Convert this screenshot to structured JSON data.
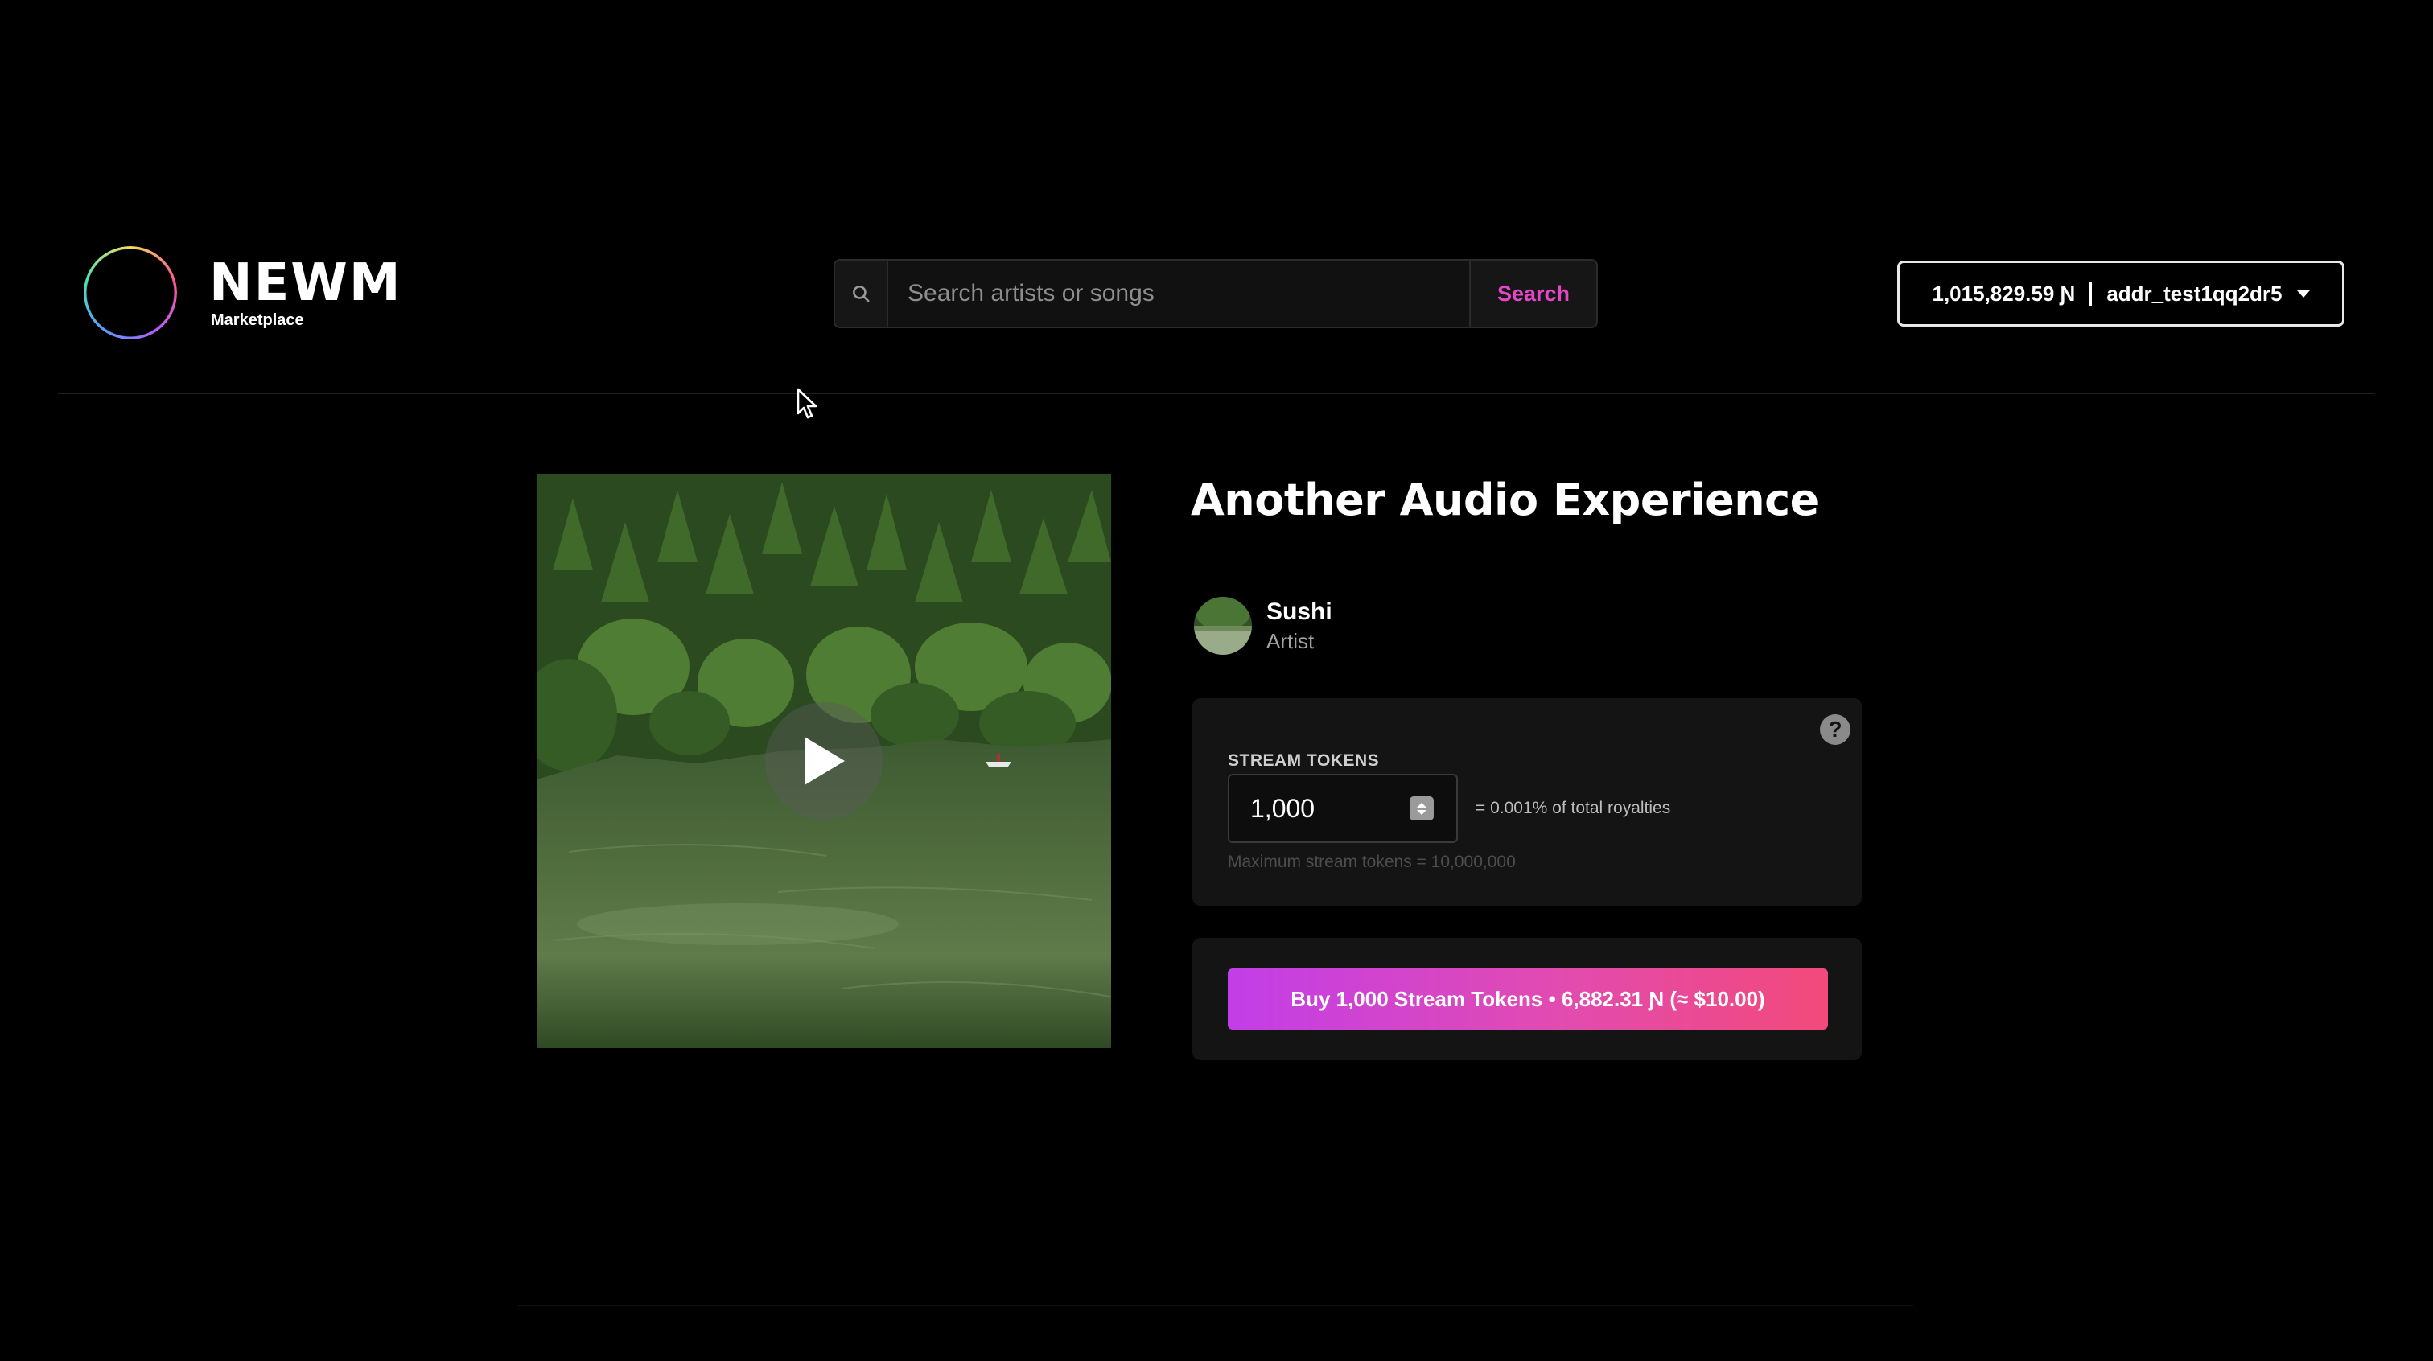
{
  "app": {
    "logo_wordmark": "NEWM",
    "logo_subtitle": "Marketplace"
  },
  "header": {
    "search": {
      "placeholder": "Search artists or songs",
      "value": "",
      "button_label": "Search",
      "icon": "search-icon"
    },
    "wallet": {
      "balance": "1,015,829.59 Ɲ",
      "address": "addr_test1qq2dr5",
      "icon": "chevron-down-icon"
    }
  },
  "song": {
    "title": "Another Audio Experience",
    "cover_alt": "Forest lake with boat",
    "play_icon": "play-icon",
    "artist": {
      "name": "Sushi",
      "role": "Artist"
    }
  },
  "purchase": {
    "tokens_label": "STREAM TOKENS",
    "tokens_value": "1,000",
    "royalty_note": "= 0.001% of total royalties",
    "max_note": "Maximum stream tokens = 10,000,000",
    "help_icon": "help-icon",
    "help_symbol": "?",
    "buy_label": "Buy 1,000 Stream Tokens • 6,882.31 Ɲ (≈ $10.00)"
  },
  "colors": {
    "background": "#000000",
    "accent_pink": "#e446c8",
    "buy_gradient_start": "#c23ee8",
    "buy_gradient_end": "#f24a7a",
    "panel": "#141414"
  }
}
